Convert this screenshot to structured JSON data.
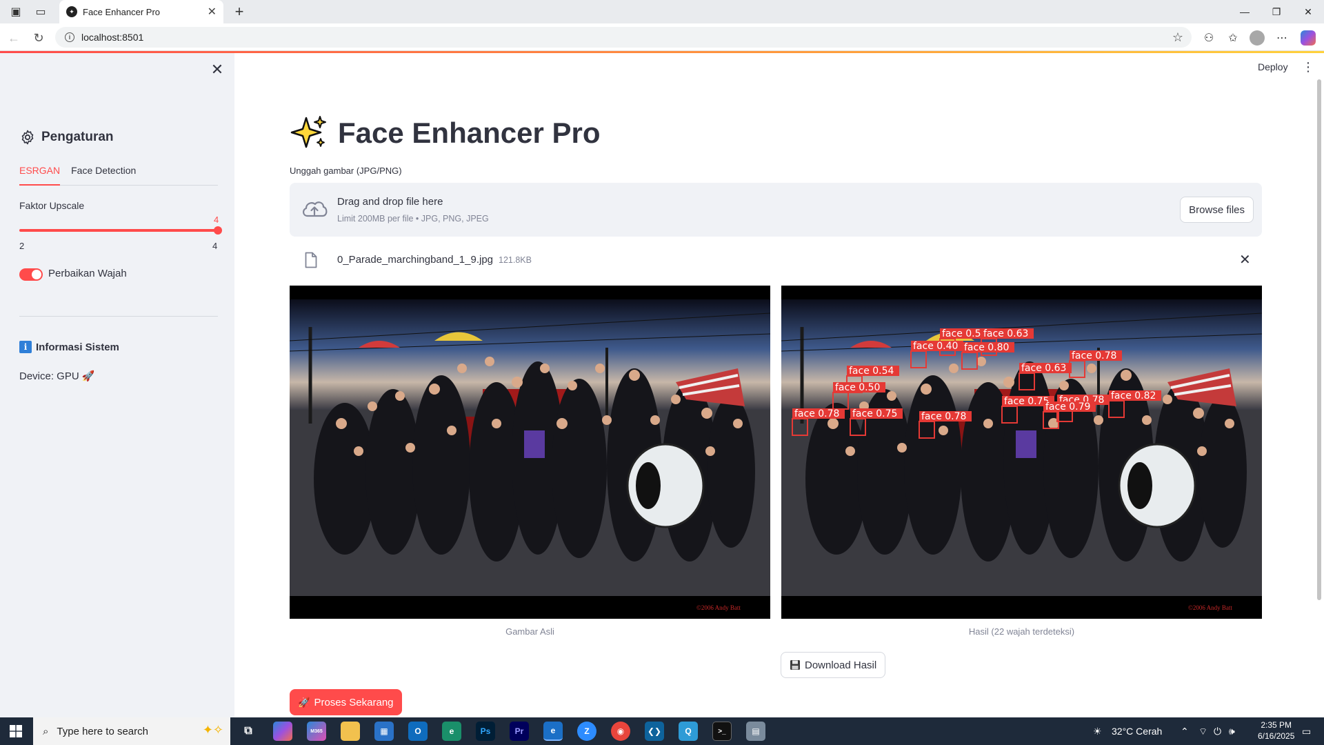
{
  "browser": {
    "tab_title": "Face Enhancer Pro",
    "url": "localhost:8501"
  },
  "sidebar": {
    "header": "Pengaturan",
    "tabs": [
      {
        "label": "ESRGAN",
        "active": true
      },
      {
        "label": "Face Detection",
        "active": false
      }
    ],
    "slider": {
      "label": "Faktor Upscale",
      "value": "4",
      "min": "2",
      "max": "4"
    },
    "toggle": {
      "label": "Perbaikan Wajah",
      "on": true
    },
    "info_title": "Informasi Sistem",
    "device": "Device: GPU 🚀"
  },
  "header": {
    "deploy": "Deploy"
  },
  "main": {
    "title": "Face Enhancer Pro",
    "upload_label": "Unggah gambar (JPG/PNG)",
    "dropzone_title": "Drag and drop file here",
    "dropzone_sub": "Limit 200MB per file • JPG, PNG, JPEG",
    "browse_label": "Browse files",
    "file_name": "0_Parade_marchingband_1_9.jpg",
    "file_size": "121.8KB",
    "caption_original": "Gambar Asli",
    "caption_result": "Hasil (22 wajah terdeteksi)",
    "download_label": "Download Hasil",
    "process_label": "Proses Sekarang",
    "watermark": "©2006 Andy Batt",
    "detections": [
      {
        "label": "face 0.57"
      },
      {
        "label": "face 0.63"
      },
      {
        "label": "face 0.40"
      },
      {
        "label": "face 0.80"
      },
      {
        "label": "face 0.78"
      },
      {
        "label": "face 0.63"
      },
      {
        "label": "face 0.54"
      },
      {
        "label": "face 0.50"
      },
      {
        "label": "face 0.78"
      },
      {
        "label": "face 0.82"
      },
      {
        "label": "face 0.78"
      },
      {
        "label": "face 0.75"
      },
      {
        "label": "face 0.79"
      },
      {
        "label": "face 0.75"
      },
      {
        "label": "face 0.78"
      }
    ]
  },
  "taskbar": {
    "search_placeholder": "Type here to search",
    "weather": "32°C  Cerah",
    "time": "2:35 PM",
    "date": "6/16/2025"
  },
  "colors": {
    "accent": "#ff4b4b",
    "sidebar_bg": "#f0f2f6",
    "box": "#e53935"
  }
}
